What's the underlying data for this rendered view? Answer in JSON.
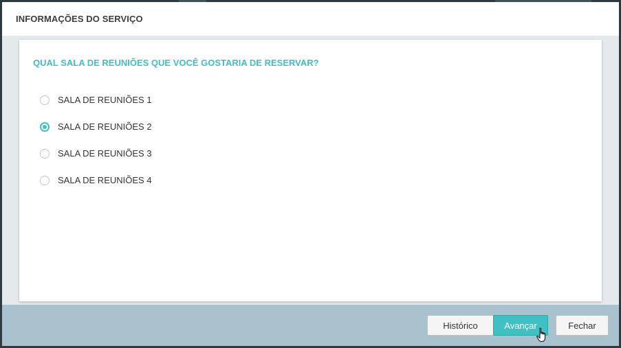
{
  "dialog": {
    "title": "INFORMAÇÕES DO SERVIÇO"
  },
  "form": {
    "question": "QUAL SALA DE REUNIÕES QUE VOCÊ GOSTARIA DE RESERVAR?",
    "options": [
      {
        "label": "SALA DE REUNIÕES 1",
        "selected": false
      },
      {
        "label": "SALA DE REUNIÕES 2",
        "selected": true
      },
      {
        "label": "SALA DE REUNIÕES 3",
        "selected": false
      },
      {
        "label": "SALA DE REUNIÕES 4",
        "selected": false
      }
    ]
  },
  "footer": {
    "history_label": "Histórico",
    "next_label": "Avançar",
    "close_label": "Fechar"
  },
  "colors": {
    "accent": "#3ec0c4",
    "footer_bg": "#a8c3ce",
    "content_bg": "#e4e9ec"
  },
  "icons": {
    "cursor": "hand-pointer-icon"
  }
}
